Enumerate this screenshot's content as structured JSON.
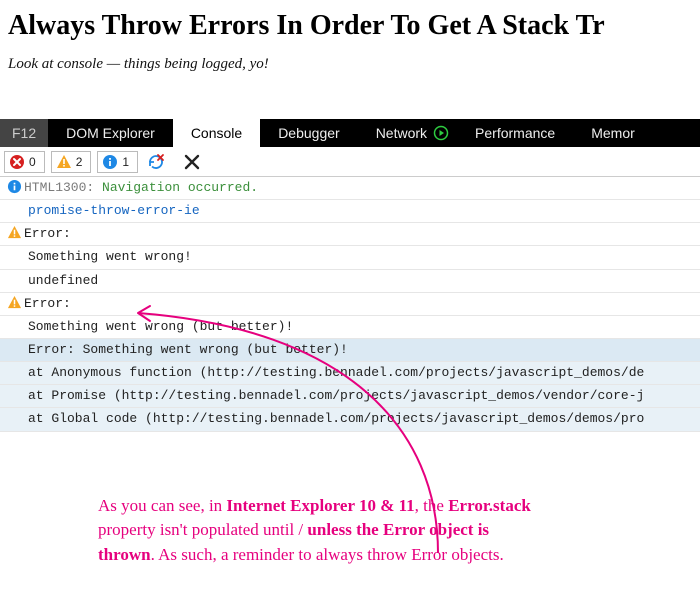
{
  "page": {
    "title": "Always Throw Errors In Order To Get A Stack Tr",
    "subtitle": "Look at console — things being logged, yo!"
  },
  "tabs": {
    "f12": "F12",
    "dom": "DOM Explorer",
    "console": "Console",
    "debugger": "Debugger",
    "network": "Network",
    "performance": "Performance",
    "memory": "Memor"
  },
  "filters": {
    "errors": "0",
    "warnings": "2",
    "info": "1"
  },
  "console": {
    "html_code": "HTML1300:",
    "nav_msg": "Navigation occurred.",
    "source_link": "promise-throw-error-ie",
    "err1_header": "Error:",
    "err1_msg": "Something went wrong!",
    "err1_stack": "undefined",
    "err2_header": "Error:",
    "err2_msg": "Something went wrong (but better)!",
    "err2_stack_hdr": "Error: Something went wrong (but better)!",
    "trace1": "at Anonymous function (http://testing.bennadel.com/projects/javascript_demos/de",
    "trace2": "at Promise (http://testing.bennadel.com/projects/javascript_demos/vendor/core-j",
    "trace3": "at Global code (http://testing.bennadel.com/projects/javascript_demos/demos/pro"
  },
  "annotation": {
    "l1a": "As you can see, in ",
    "l1b": "Internet Explorer 10 & 11",
    "l1c": ", the ",
    "l1d": "Error.stack",
    "l2a": "property isn't populated until / ",
    "l2b": "unless the Error object is",
    "l3a": "thrown",
    "l3b": ". As such, a reminder to always throw Error objects."
  }
}
